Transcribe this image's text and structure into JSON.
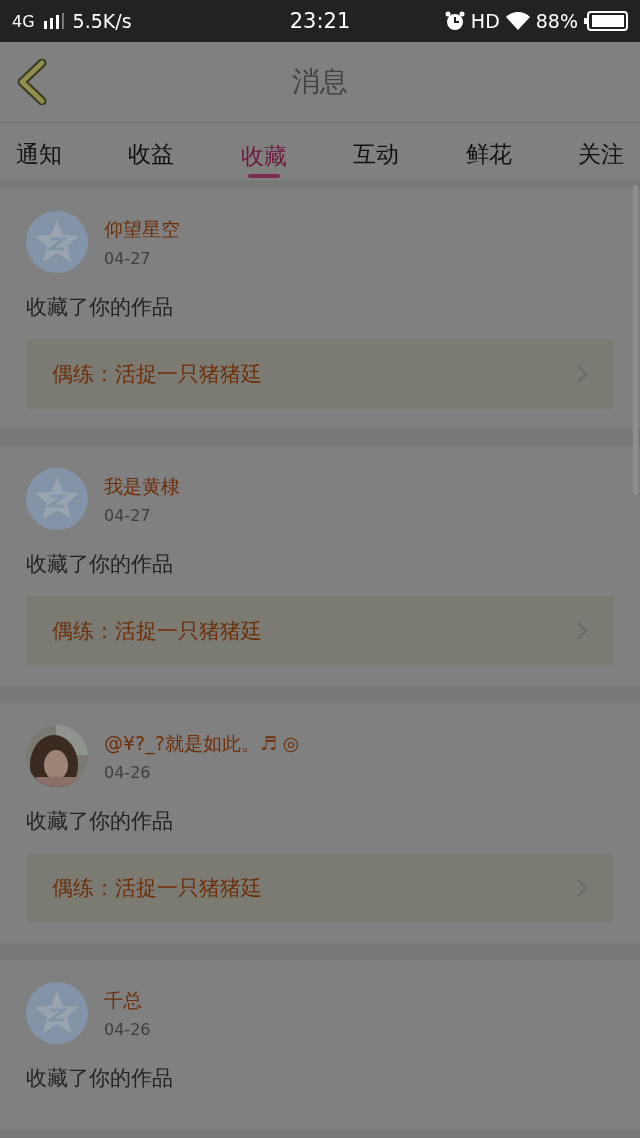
{
  "status_bar": {
    "network": "4G",
    "speed": "5.5K/s",
    "time": "23:21",
    "hd": "HD",
    "battery": "88%"
  },
  "header": {
    "title": "消息"
  },
  "tabs": [
    {
      "label": "通知",
      "selected": false
    },
    {
      "label": "收益",
      "selected": false
    },
    {
      "label": "收藏",
      "selected": true
    },
    {
      "label": "互动",
      "selected": false
    },
    {
      "label": "鲜花",
      "selected": false
    },
    {
      "label": "关注",
      "selected": false
    }
  ],
  "messages": [
    {
      "kind": "default",
      "name": "仰望星空",
      "date": "04-27",
      "text": "收藏了你的作品",
      "work": "偶练：活捉一只猪猪廷"
    },
    {
      "kind": "default",
      "name": "我是黄棣",
      "date": "04-27",
      "text": "收藏了你的作品",
      "work": "偶练：活捉一只猪猪廷"
    },
    {
      "kind": "picture",
      "name": "@¥?_?就是如此。♬ ◎",
      "date": "04-26",
      "text": "收藏了你的作品",
      "work": "偶练：活捉一只猪猪廷"
    },
    {
      "kind": "default",
      "name": "千总",
      "date": "04-26",
      "text": "收藏了你的作品"
    }
  ]
}
